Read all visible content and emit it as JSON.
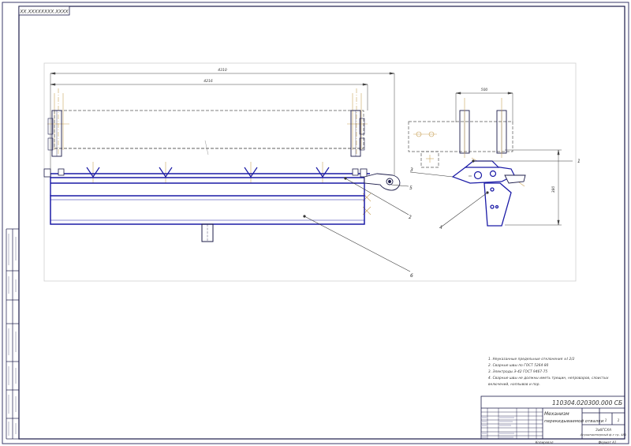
{
  "stamp": {
    "corner_code": "ХХ.ХХХХХХХХ.ХХХХ",
    "designation": "110304.020300.000 СБ",
    "title_line1": "Механизм",
    "title_line2": "перекидываемой отвалки",
    "sheet": "1",
    "sheets": "1",
    "group_line1": "ЗабГСХА",
    "group_line2": "Агроинженерный ф-т гр. 481",
    "bottom_left": "Копировал",
    "bottom_right": "Формат А1"
  },
  "dimensions": {
    "overall_width": "4310",
    "inner_width": "4216",
    "side_width": "500",
    "side_height": "380"
  },
  "callouts": [
    "1",
    "2",
    "3",
    "4",
    "5",
    "6"
  ],
  "notes": [
    "1. Неуказанные предельные отклонения ±t 2/2",
    "2. Сварные швы по ГОСТ 5264-80",
    "3. Электроды Э-42 ГОСТ 9467-75",
    "4. Сварные швы не должны иметь трещин, непроваров, слоистых",
    "включений, наплывов и пор."
  ],
  "colors": {
    "part_outline": "#1a1aa6",
    "frame_line": "#1c1c4a",
    "construction": "#c9a35a"
  }
}
